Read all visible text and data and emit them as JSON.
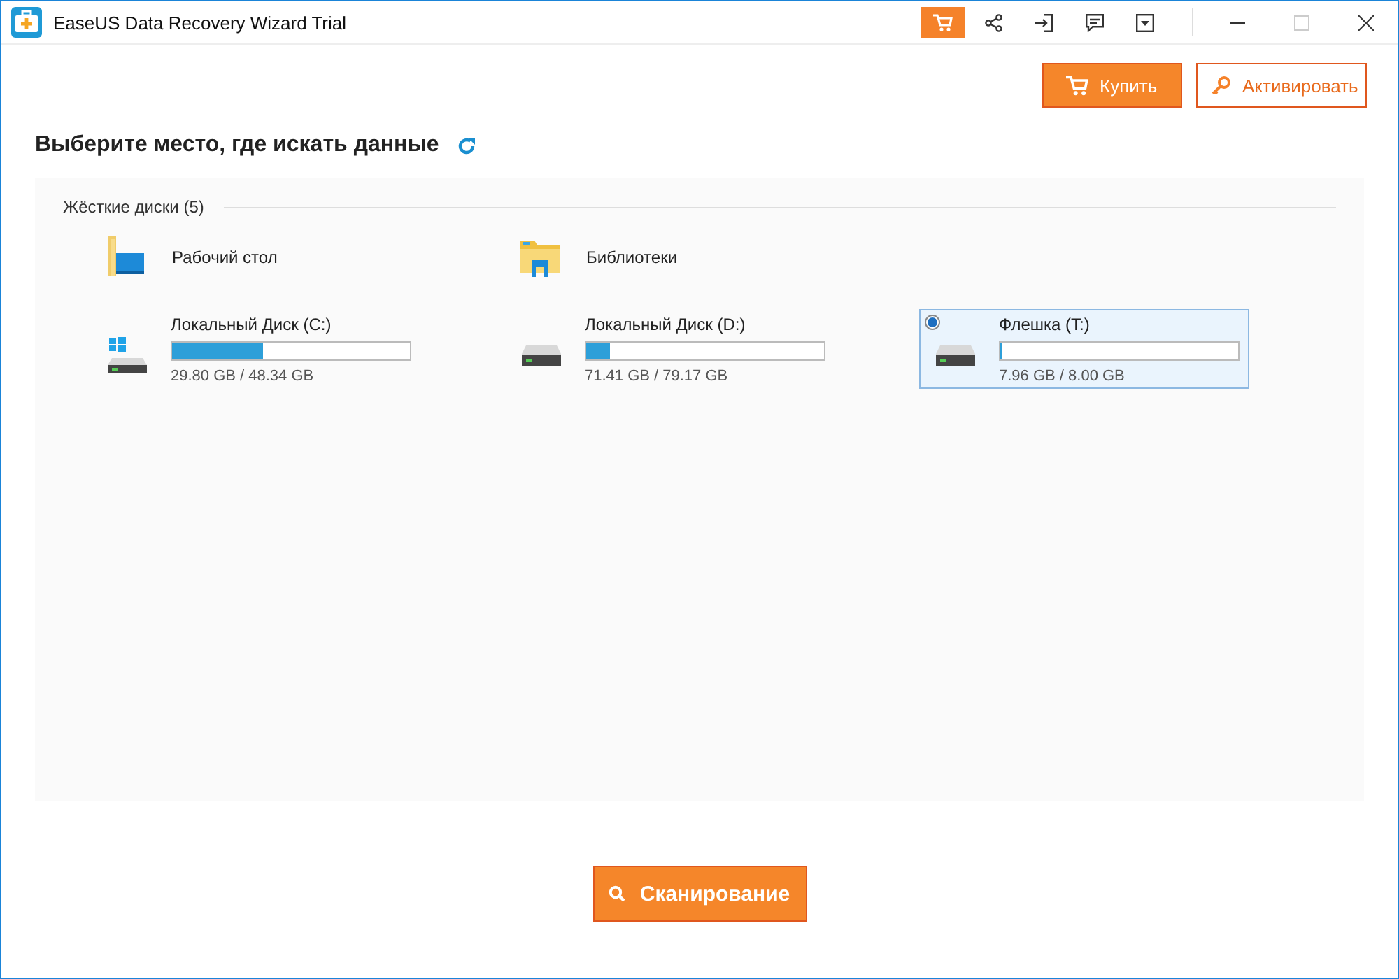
{
  "window": {
    "title": "EaseUS Data Recovery Wizard Trial"
  },
  "toolbar": [
    {
      "kind": "cart",
      "selected": true
    },
    {
      "kind": "share",
      "selected": false
    },
    {
      "kind": "login",
      "selected": false
    },
    {
      "kind": "feedback",
      "selected": false
    },
    {
      "kind": "dropdown",
      "selected": false
    }
  ],
  "window_controls": [
    {
      "kind": "minimize",
      "disabled": false
    },
    {
      "kind": "maximize",
      "disabled": true
    },
    {
      "kind": "close",
      "disabled": false
    }
  ],
  "header_buttons": [
    {
      "kind": "buy",
      "label": "Купить"
    },
    {
      "kind": "activate",
      "label": "Активировать"
    }
  ],
  "heading": "Выберите место, где искать данные",
  "section": {
    "title": "Жёсткие диски (5)"
  },
  "locations": [
    {
      "kind": "desktop",
      "label": "Рабочий стол"
    },
    {
      "kind": "libraries",
      "label": "Библиотеки"
    }
  ],
  "drives": [
    {
      "kind": "system",
      "name": "Локальный Диск (C:)",
      "level": 0.38,
      "usage": "29.80 GB / 48.34 GB",
      "selected": false
    },
    {
      "kind": "disk",
      "name": "Локальный Диск (D:)",
      "level": 0.1,
      "usage": "71.41 GB / 79.17 GB",
      "selected": false
    },
    {
      "kind": "disk",
      "name": "Флешка (T:)",
      "level": 0.005,
      "usage": "7.96 GB / 8.00 GB",
      "selected": true
    }
  ],
  "scan_button": {
    "label": "Сканирование"
  }
}
